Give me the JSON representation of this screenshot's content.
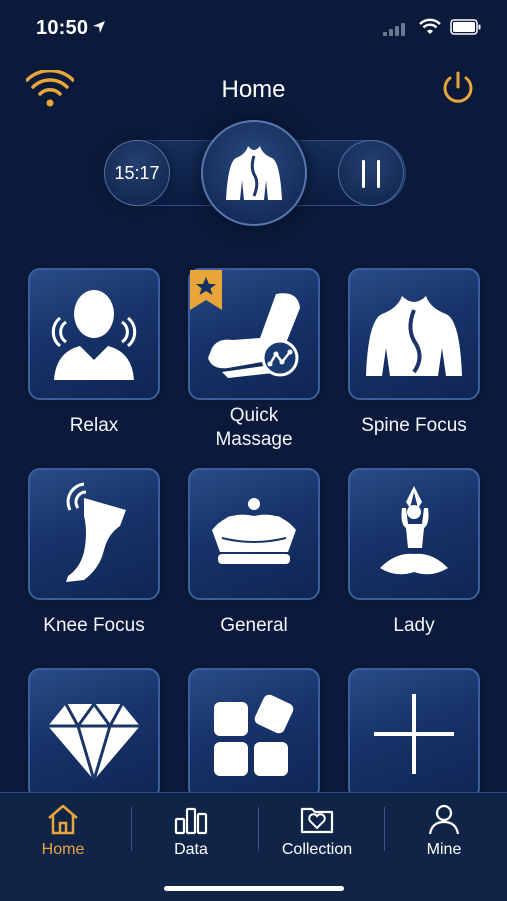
{
  "status_bar": {
    "time": "10:50"
  },
  "header": {
    "title": "Home",
    "wifi_icon": "wifi-icon",
    "power_icon": "power-icon"
  },
  "controls": {
    "timer": "15:17",
    "center_icon": "back-body-icon",
    "pause_icon": "pause-icon"
  },
  "programs": [
    {
      "label": "Relax",
      "icon": "head-massage-icon"
    },
    {
      "label": "Quick\nMassage",
      "icon": "massage-chair-icon",
      "badge": "star-bookmark-icon"
    },
    {
      "label": "Spine Focus",
      "icon": "back-body-icon"
    },
    {
      "label": "Knee Focus",
      "icon": "leg-icon"
    },
    {
      "label": "General",
      "icon": "crown-icon"
    },
    {
      "label": "Lady",
      "icon": "yoga-icon"
    },
    {
      "label": "",
      "icon": "diamond-icon"
    },
    {
      "label": "",
      "icon": "apps-grid-icon"
    },
    {
      "label": "",
      "icon": "plus-icon"
    }
  ],
  "tabs": [
    {
      "label": "Home",
      "icon": "home-icon",
      "active": true
    },
    {
      "label": "Data",
      "icon": "bar-chart-icon",
      "active": false
    },
    {
      "label": "Collection",
      "icon": "folder-heart-icon",
      "active": false
    },
    {
      "label": "Mine",
      "icon": "user-icon",
      "active": false
    }
  ],
  "colors": {
    "background": "#0b1a3a",
    "accent": "#e8a53a",
    "tile": "#1a3a72"
  }
}
